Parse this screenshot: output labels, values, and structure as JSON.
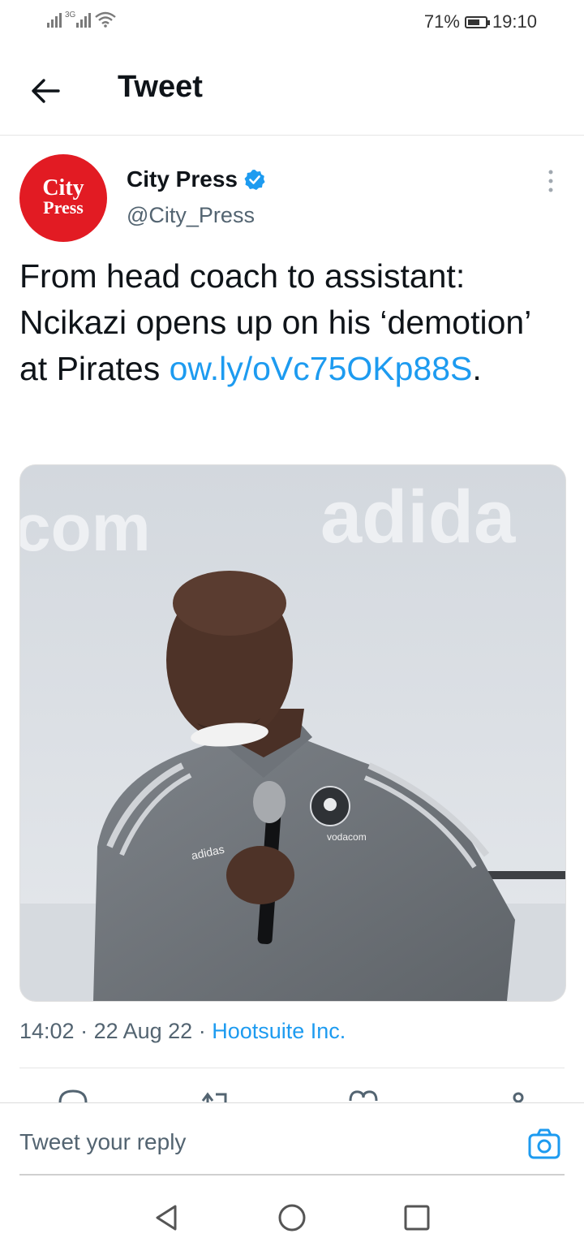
{
  "status_bar": {
    "network_label": "3G",
    "battery_percent": "71%",
    "time": "19:10"
  },
  "header": {
    "title": "Tweet"
  },
  "tweet": {
    "avatar_line1": "City",
    "avatar_line2": "Press",
    "author_name": "City Press",
    "author_handle": "@City_Press",
    "text_main": "From head coach to assistant: Ncikazi opens up on his ‘demotion’ at Pirates ",
    "link_text": "ow.ly/​oVc75OKp88S",
    "text_end": ".",
    "media_wall_text_left": "com",
    "media_wall_text_right": "adida",
    "media_jacket_brand": "adidas",
    "media_sponsor": "vodacom",
    "time": "14:02",
    "date": "22 Aug 22",
    "source": "Hootsuite Inc."
  },
  "reply": {
    "placeholder": "Tweet your reply"
  },
  "colors": {
    "accent": "#1d9bf0",
    "brand_red": "#e21b23"
  },
  "icons": [
    "back-arrow-icon",
    "verified-badge-icon",
    "more-vertical-icon",
    "reply-icon",
    "retweet-icon",
    "like-icon",
    "share-icon",
    "camera-icon",
    "nav-back-icon",
    "nav-home-icon",
    "nav-recents-icon"
  ]
}
